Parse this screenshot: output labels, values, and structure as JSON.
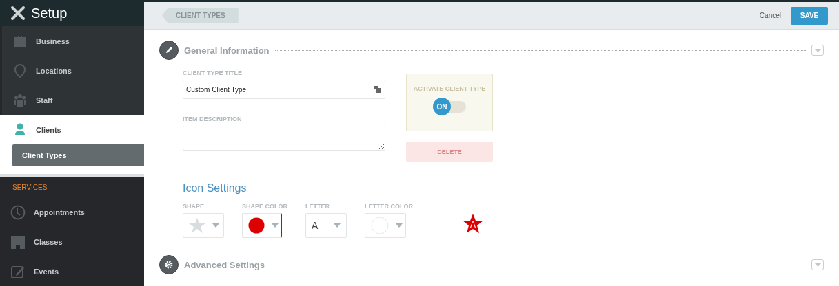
{
  "sidebar": {
    "title": "Setup",
    "groups": [
      {
        "items": [
          {
            "label": "Business",
            "selected": false
          },
          {
            "label": "Locations",
            "selected": false
          },
          {
            "label": "Staff",
            "selected": false
          },
          {
            "label": "Clients",
            "selected": true,
            "children": [
              {
                "label": "Client Types",
                "selected": true
              }
            ]
          }
        ]
      },
      {
        "heading": "SERVICES",
        "items": [
          {
            "label": "Appointments",
            "selected": false
          },
          {
            "label": "Classes",
            "selected": false
          },
          {
            "label": "Events",
            "selected": false
          }
        ]
      }
    ]
  },
  "top_bar": {
    "back_link": "CLIENT TYPES",
    "cancel": "Cancel",
    "save": "SAVE"
  },
  "general_information": {
    "title": "General Information",
    "title_field": {
      "label": "CLIENT TYPE TITLE",
      "value": "Custom Client Type"
    },
    "description_field": {
      "label": "ITEM DESCRIPTION"
    },
    "activate": {
      "label": "ACTIVATE CLIENT TYPE",
      "on": true,
      "toggle_text": "ON"
    },
    "delete": "DELETE"
  },
  "icon_settings": {
    "title": "Icon Settings",
    "shape": {
      "label": "SHAPE",
      "kind": "star"
    },
    "shape_color": {
      "label": "SHAPE COLOR",
      "color": "#dd0000"
    },
    "letter": {
      "label": "LETTER",
      "value": "A"
    },
    "letter_color": {
      "label": "LETTER COLOR",
      "color": "#ffffff"
    },
    "preview_letter": "A"
  },
  "advanced_settings": {
    "title": "Advanced Settings"
  }
}
